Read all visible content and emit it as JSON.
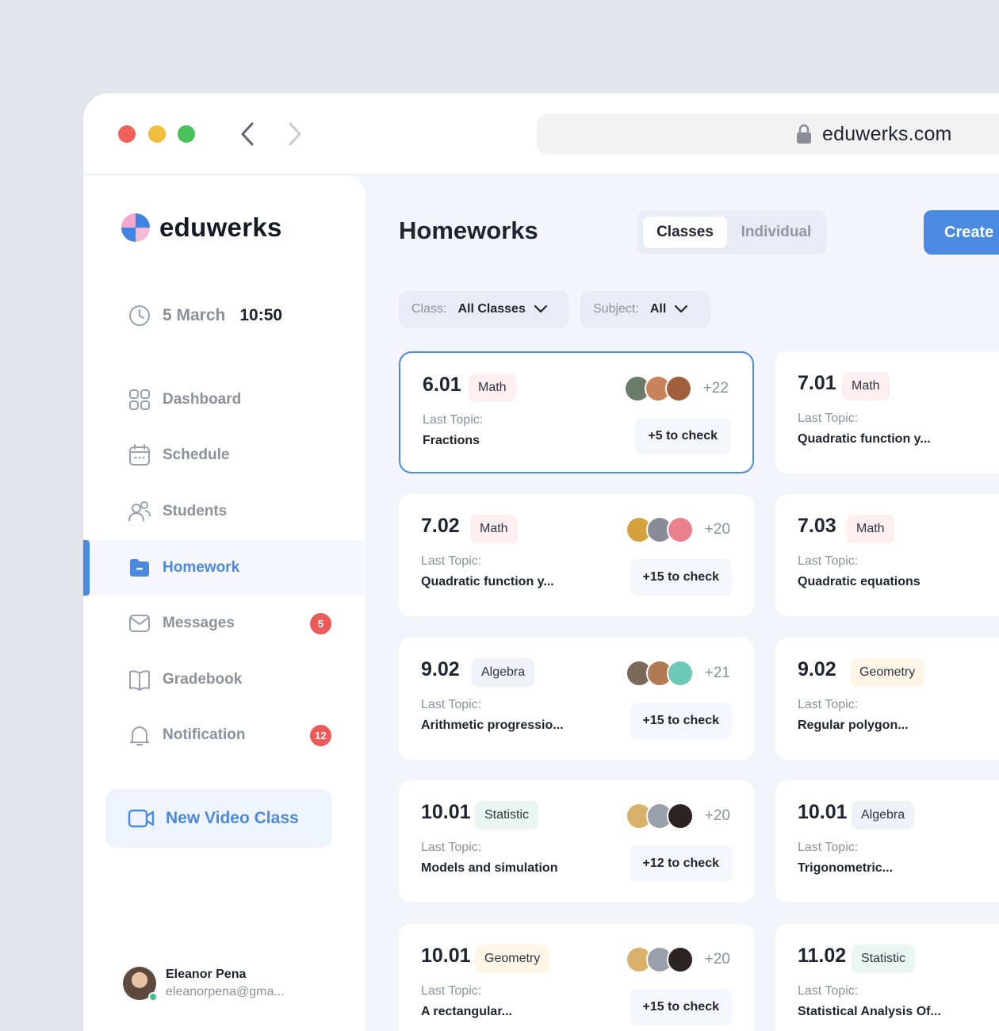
{
  "browser": {
    "url": "eduwerks.com"
  },
  "sidebar": {
    "logo_text": "eduwerks",
    "date": "5 March",
    "time": "10:50",
    "items": [
      {
        "label": "Dashboard"
      },
      {
        "label": "Schedule"
      },
      {
        "label": "Students"
      },
      {
        "label": "Homework"
      },
      {
        "label": "Messages",
        "badge": "5"
      },
      {
        "label": "Gradebook"
      },
      {
        "label": "Notification",
        "badge": "12"
      }
    ],
    "video_button": "New Video Class",
    "profile": {
      "name": "Eleanor Pena",
      "email": "eleanorpena@gma..."
    }
  },
  "header": {
    "title": "Homeworks",
    "tabs": [
      "Classes",
      "Individual"
    ],
    "create_label": "Create"
  },
  "filters": {
    "class_label": "Class:",
    "class_value": "All Classes",
    "subject_label": "Subject:",
    "subject_value": "All"
  },
  "colors": {
    "accent": "#4a8ae0",
    "badge": "#ec5a5a",
    "math_tag": "#fdeef0",
    "algebra_tag": "#eff1f7",
    "geometry_tag": "#fdf6e6",
    "statistic_tag": "#eaf6f1"
  },
  "cards": [
    {
      "class": "6.01",
      "subject": "Math",
      "topic_label": "Last Topic:",
      "topic": "Fractions",
      "extra": "+22",
      "check": "+5 to check"
    },
    {
      "class": "7.01",
      "subject": "Math",
      "topic_label": "Last Topic:",
      "topic": "Quadratic function y..."
    },
    {
      "class": "7.02",
      "subject": "Math",
      "topic_label": "Last Topic:",
      "topic": "Quadratic function y...",
      "extra": "+20",
      "check": "+15 to check"
    },
    {
      "class": "7.03",
      "subject": "Math",
      "topic_label": "Last Topic:",
      "topic": "Quadratic equations"
    },
    {
      "class": "9.02",
      "subject": "Algebra",
      "topic_label": "Last Topic:",
      "topic": "Arithmetic progressio...",
      "extra": "+21",
      "check": "+15 to check"
    },
    {
      "class": "9.02",
      "subject": "Geometry",
      "topic_label": "Last Topic:",
      "topic": "Regular polygon..."
    },
    {
      "class": "10.01",
      "subject": "Statistic",
      "topic_label": "Last Topic:",
      "topic": "Models and simulation",
      "extra": "+20",
      "check": "+12 to check"
    },
    {
      "class": "10.01",
      "subject": "Algebra",
      "topic_label": "Last Topic:",
      "topic": "Trigonometric..."
    },
    {
      "class": "10.01",
      "subject": "Geometry",
      "topic_label": "Last Topic:",
      "topic": "A rectangular...",
      "extra": "+20",
      "check": "+15 to check"
    },
    {
      "class": "11.02",
      "subject": "Statistic",
      "topic_label": "Last Topic:",
      "topic": "Statistical Analysis Of..."
    }
  ]
}
